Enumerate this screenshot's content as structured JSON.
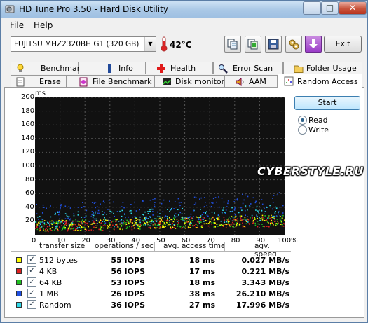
{
  "window": {
    "title": "HD Tune Pro 3.50 - Hard Disk Utility"
  },
  "menu": {
    "file": "File",
    "help": "Help"
  },
  "toolbar": {
    "drive": "FUJITSU MHZ2320BH G1 (320 GB)",
    "temperature": "42°C",
    "exit_label": "Exit",
    "icons": [
      "copy-text-icon",
      "copy-screenshot-icon",
      "save-icon",
      "options-icon",
      "download-icon"
    ]
  },
  "tabs_top": [
    "Benchmark",
    "Info",
    "Health",
    "Error Scan",
    "Folder Usage"
  ],
  "tabs_bottom": [
    "Erase",
    "File Benchmark",
    "Disk monitor",
    "AAM",
    "Random Access"
  ],
  "active_tab": "Random Access",
  "controls": {
    "start_label": "Start",
    "read_label": "Read",
    "write_label": "Write",
    "mode": "Read"
  },
  "watermark": "CYBERSTYLE.RU",
  "chart_data": {
    "type": "scatter",
    "ylabel": "ms",
    "ylim": [
      0,
      200
    ],
    "yticks": [
      "200",
      "180",
      "160",
      "140",
      "120",
      "100",
      "80",
      "60",
      "40",
      "20"
    ],
    "xlim": [
      0,
      100
    ],
    "xticks": [
      "0",
      "10",
      "20",
      "30",
      "40",
      "50",
      "60",
      "70",
      "80",
      "90",
      "100%"
    ],
    "grid": true,
    "series": [
      {
        "name": "512 bytes",
        "color": "#ffff00",
        "avg_ms": 18
      },
      {
        "name": "4 KB",
        "color": "#e02020",
        "avg_ms": 17
      },
      {
        "name": "64 KB",
        "color": "#20c020",
        "avg_ms": 18
      },
      {
        "name": "1 MB",
        "color": "#2050e0",
        "avg_ms": 38
      },
      {
        "name": "Random",
        "color": "#30d8e8",
        "avg_ms": 27
      }
    ]
  },
  "results": {
    "headers": [
      "transfer size",
      "operations / sec",
      "avg. access time",
      "agv. speed"
    ],
    "rows": [
      {
        "size": "512 bytes",
        "color": "#ffff00",
        "ops": "55 IOPS",
        "time": "18 ms",
        "speed": "0.027 MB/s"
      },
      {
        "size": "4 KB",
        "color": "#e02020",
        "ops": "56 IOPS",
        "time": "17 ms",
        "speed": "0.221 MB/s"
      },
      {
        "size": "64 KB",
        "color": "#20c020",
        "ops": "53 IOPS",
        "time": "18 ms",
        "speed": "3.343 MB/s"
      },
      {
        "size": "1 MB",
        "color": "#2050e0",
        "ops": "26 IOPS",
        "time": "38 ms",
        "speed": "26.210 MB/s"
      },
      {
        "size": "Random",
        "color": "#30d8e8",
        "ops": "36 IOPS",
        "time": "27 ms",
        "speed": "17.996 MB/s"
      }
    ]
  }
}
